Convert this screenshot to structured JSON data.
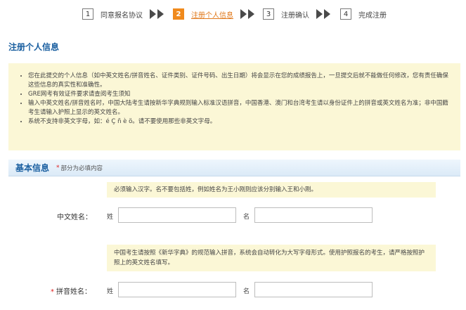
{
  "steps": [
    {
      "num": "1",
      "label": "同意报名协议"
    },
    {
      "num": "2",
      "label": "注册个人信息"
    },
    {
      "num": "3",
      "label": "注册确认"
    },
    {
      "num": "4",
      "label": "完成注册"
    }
  ],
  "page_title": "注册个人信息",
  "notice_items": [
    "您在此提交的个人信息（如中英文姓名/拼音姓名、证件类别、证件号码、出生日期）将会显示在您的成绩报告上，一旦提交后就不能做任何修改，您有责任确保这些信息的真实性和准确性。",
    "GRE网考有效证件要求请查阅考生须知",
    "输入中英文姓名/拼音姓名时，中国大陆考生请按新华字典规则输入标准汉语拼音，中国香港、澳门和台湾考生请以身份证件上的拼音或英文姓名为准；非中国籍考生请输入护照上显示的英文姓名。",
    "系统不支持非英文字母，如：é Ç ñ è ö。请不要使用那些非英文字母。"
  ],
  "section": {
    "title": "基本信息",
    "required_star": "*",
    "required_note": "部分为必填内容"
  },
  "chinese_name": {
    "hint": "必须输入汉字。名不要包括姓，例如姓名为王小刚则应该分别输入王和小刚。",
    "label": "中文姓名：",
    "surname_label": "姓",
    "given_label": "名",
    "surname_value": "",
    "given_value": ""
  },
  "pinyin_name": {
    "hint": "中国考生请按照《新华字典》的规范输入拼音，系统会自动转化为大写字母形式。使用护照报名的考生，请严格按照护照上的英文姓名填写。",
    "required_star": "*",
    "label": "拼音姓名：",
    "surname_label": "姓",
    "given_label": "名",
    "surname_value": "",
    "given_value": ""
  },
  "colors": {
    "accent": "#f08a1c",
    "title_blue": "#1a5fa0",
    "notice_bg": "#fbf7d6",
    "required": "#e02020"
  }
}
